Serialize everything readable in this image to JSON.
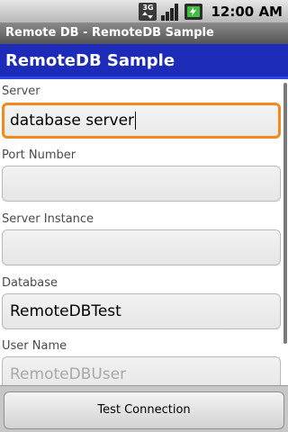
{
  "status_bar": {
    "network": "3G",
    "time": "12:00 AM",
    "icons": [
      "3g-icon",
      "signal-icon",
      "battery-charging-icon"
    ]
  },
  "window": {
    "title": "Remote DB - RemoteDB Sample"
  },
  "header": {
    "title": "RemoteDB Sample"
  },
  "form": {
    "fields": [
      {
        "label": "Server",
        "value": "database server",
        "focused": true
      },
      {
        "label": "Port Number",
        "value": ""
      },
      {
        "label": "Server Instance",
        "value": ""
      },
      {
        "label": "Database",
        "value": "RemoteDBTest"
      },
      {
        "label": "User Name",
        "value": "",
        "placeholder": "RemoteDBUser"
      }
    ]
  },
  "footer": {
    "test_button": "Test Connection"
  },
  "colors": {
    "header_blue": "#1c2bb8",
    "focus_orange": "#f08a1c",
    "title_bar": "#555555"
  }
}
